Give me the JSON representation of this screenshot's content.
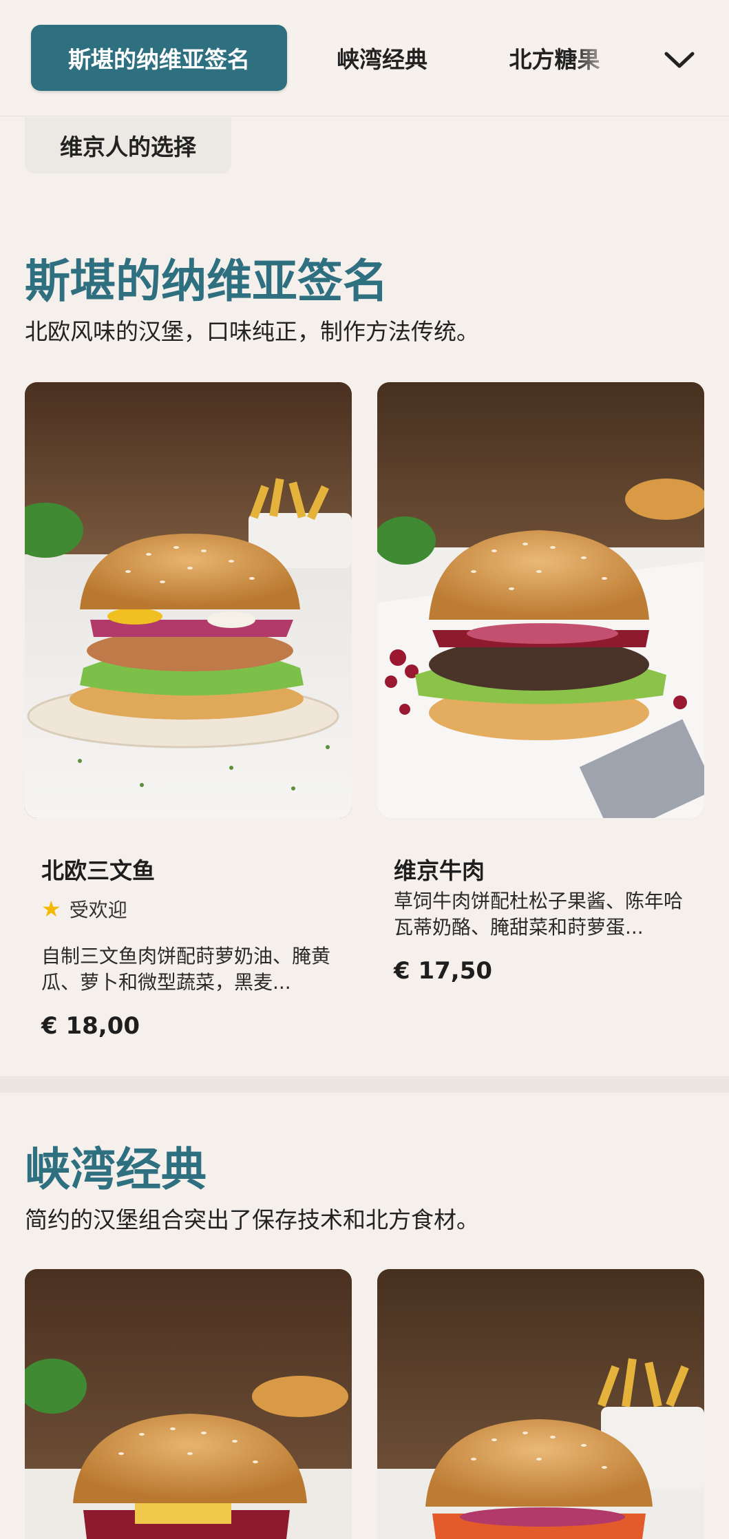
{
  "nav": {
    "tabs": [
      {
        "label": "斯堪的纳维亚签名",
        "active": true
      },
      {
        "label": "峡湾经典",
        "active": false
      },
      {
        "label": "北方糖果",
        "active": false
      },
      {
        "label": "维京人的选择",
        "active": false
      }
    ],
    "expand_icon": "chevron-down-icon"
  },
  "sections": [
    {
      "title": "斯堪的纳维亚签名",
      "description": "北欧风味的汉堡，口味纯正，制作方法传统。",
      "items": [
        {
          "name": "北欧三文鱼",
          "badge": "受欢迎",
          "badge_icon": "star-icon",
          "description": "自制三文鱼肉饼配莳萝奶油、腌黄瓜、萝卜和微型蔬菜，黑麦...",
          "price": "€ 18,00"
        },
        {
          "name": "维京牛肉",
          "description": "草饲牛肉饼配杜松子果酱、陈年哈瓦蒂奶酪、腌甜菜和莳萝蛋...",
          "price": "€ 17,50"
        }
      ]
    },
    {
      "title": "峡湾经典",
      "description": "简约的汉堡组合突出了保存技术和北方食材。"
    }
  ],
  "colors": {
    "accent": "#2e6f80",
    "background": "#f5f0ec",
    "badge_star": "#f2b900"
  }
}
